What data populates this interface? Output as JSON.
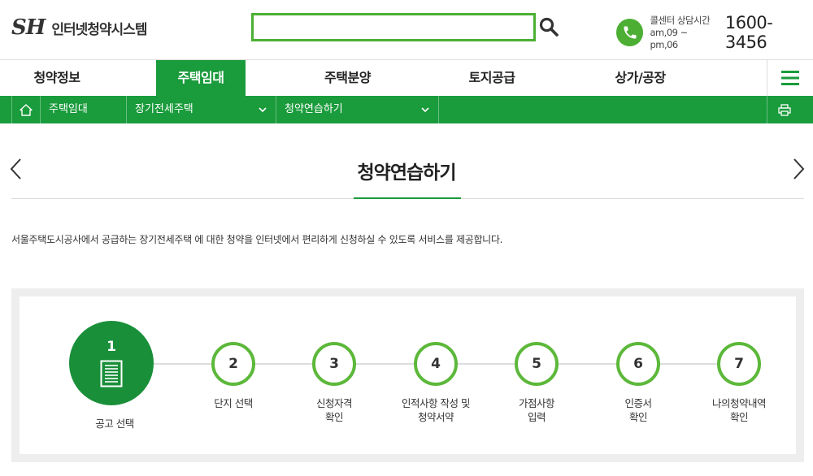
{
  "header": {
    "logo_mark": "SH",
    "logo_text": "인터넷청약시스템",
    "search_placeholder": "",
    "call": {
      "label": "콜센터 상담시간",
      "hours": "am,09 ~ pm,06",
      "number": "1600-3456"
    }
  },
  "gnb": {
    "items": [
      {
        "label": "청약정보"
      },
      {
        "label": "주택임대"
      },
      {
        "label": "주택분양"
      },
      {
        "label": "토지공급"
      },
      {
        "label": "상가/공장"
      }
    ],
    "active_index": 1
  },
  "location": {
    "level1": "주택임대",
    "level2": "장기전세주택",
    "level3": "청약연습하기"
  },
  "page": {
    "title": "청약연습하기",
    "intro": "서울주택도시공사에서 공급하는 장기전세주택 에 대한 청약을 인터넷에서 편리하게 신청하실 수 있도록 서비스를 제공합니다."
  },
  "steps": [
    {
      "num": "1",
      "line1": "공고 선택",
      "line2": "",
      "active": true
    },
    {
      "num": "2",
      "line1": "단지 선택",
      "line2": "",
      "active": false
    },
    {
      "num": "3",
      "line1": "신청자격",
      "line2": "확인",
      "active": false
    },
    {
      "num": "4",
      "line1": "인적사항 작성 및",
      "line2": "청약서약",
      "active": false
    },
    {
      "num": "5",
      "line1": "가점사항",
      "line2": "입력",
      "active": false
    },
    {
      "num": "6",
      "line1": "인증서",
      "line2": "확인",
      "active": false
    },
    {
      "num": "7",
      "line1": "나의청약내역",
      "line2": "확인",
      "active": false
    }
  ],
  "colors": {
    "brand_green": "#1a9b3c",
    "step_ring": "#5cb83a",
    "search_border": "#4caf34"
  },
  "icons": {
    "search": "search-icon",
    "phone": "phone-icon",
    "menu": "hamburger-icon",
    "home": "home-icon",
    "print": "print-icon",
    "document": "document-icon"
  }
}
